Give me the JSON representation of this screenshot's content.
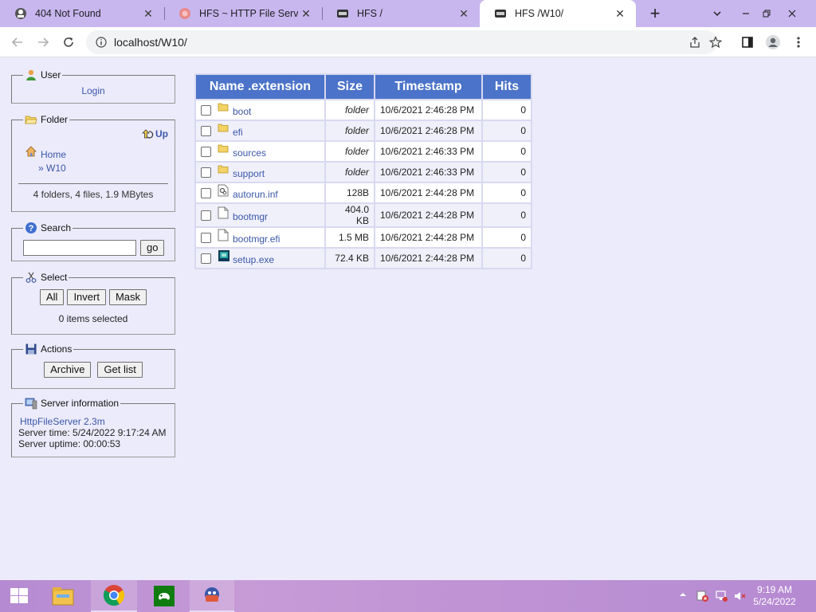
{
  "browser": {
    "tabs": [
      {
        "title": "404 Not Found",
        "icon": "hfs-icon",
        "active": false
      },
      {
        "title": "HFS ~ HTTP File Server d",
        "icon": "hfs-site-icon",
        "active": false
      },
      {
        "title": "HFS /",
        "icon": "hfs-logo-icon",
        "active": false
      },
      {
        "title": "HFS /W10/",
        "icon": "hfs-logo-icon",
        "active": true
      }
    ],
    "new_tab_label": "+",
    "url": "localhost/W10/"
  },
  "sidebar": {
    "user": {
      "legend": "User",
      "login": "Login"
    },
    "folder": {
      "legend": "Folder",
      "up": "Up",
      "home": "Home",
      "current": "» W10",
      "summary": "4 folders, 4 files, 1.9 MBytes"
    },
    "search": {
      "legend": "Search",
      "go": "go",
      "value": ""
    },
    "select": {
      "legend": "Select",
      "all": "All",
      "invert": "Invert",
      "mask": "Mask",
      "status": "0 items selected"
    },
    "actions": {
      "legend": "Actions",
      "archive": "Archive",
      "getlist": "Get list"
    },
    "server": {
      "legend": "Server information",
      "version": "HttpFileServer 2.3m",
      "time": "Server time: 5/24/2022 9:17:24 AM",
      "uptime": "Server uptime: 00:00:53"
    }
  },
  "table": {
    "headers": {
      "name": "Name .extension",
      "size": "Size",
      "timestamp": "Timestamp",
      "hits": "Hits"
    },
    "rows": [
      {
        "name": "boot",
        "size": "folder",
        "timestamp": "10/6/2021 2:46:28 PM",
        "hits": "0",
        "icon": "folder-icon"
      },
      {
        "name": "efi",
        "size": "folder",
        "timestamp": "10/6/2021 2:46:28 PM",
        "hits": "0",
        "icon": "folder-icon"
      },
      {
        "name": "sources",
        "size": "folder",
        "timestamp": "10/6/2021 2:46:33 PM",
        "hits": "0",
        "icon": "folder-icon"
      },
      {
        "name": "support",
        "size": "folder",
        "timestamp": "10/6/2021 2:46:33 PM",
        "hits": "0",
        "icon": "folder-icon"
      },
      {
        "name": "autorun.inf",
        "size": "128B",
        "timestamp": "10/6/2021 2:44:28 PM",
        "hits": "0",
        "icon": "settings-file-icon"
      },
      {
        "name": "bootmgr",
        "size": "404.0 KB",
        "timestamp": "10/6/2021 2:44:28 PM",
        "hits": "0",
        "icon": "file-icon"
      },
      {
        "name": "bootmgr.efi",
        "size": "1.5 MB",
        "timestamp": "10/6/2021 2:44:28 PM",
        "hits": "0",
        "icon": "file-icon"
      },
      {
        "name": "setup.exe",
        "size": "72.4 KB",
        "timestamp": "10/6/2021 2:44:28 PM",
        "hits": "0",
        "icon": "exe-icon"
      }
    ]
  },
  "taskbar": {
    "clock_time": "9:19 AM",
    "clock_date": "5/24/2022"
  },
  "colors": {
    "table_header": "#4b73c9",
    "link": "#3a57a8",
    "page_bg": "#ecebfb",
    "tabstrip": "#c8b7ee"
  }
}
